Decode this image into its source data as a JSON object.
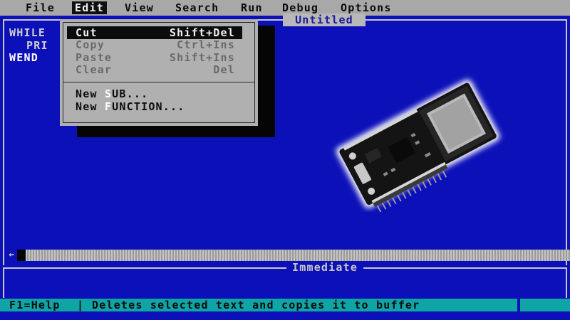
{
  "menubar": {
    "items": [
      "File",
      "Edit",
      "View",
      "Search",
      "Run",
      "Debug",
      "Options"
    ]
  },
  "editor": {
    "title": "Untitled",
    "code_lines": [
      "WHILE",
      "PRI",
      "WEND"
    ]
  },
  "edit_menu": {
    "items": [
      {
        "label": "Cut",
        "shortcut": "Shift+Del",
        "state": "selected"
      },
      {
        "label": "Copy",
        "shortcut": "Ctrl+Ins",
        "state": "disabled"
      },
      {
        "label": "Paste",
        "shortcut": "Shift+Ins",
        "state": "disabled"
      },
      {
        "label": "Clear",
        "shortcut": "Del",
        "state": "disabled"
      }
    ],
    "new_sub": {
      "prefix": "New ",
      "hotkey": "S",
      "rest": "UB..."
    },
    "new_function": {
      "prefix": "New ",
      "hotkey": "F",
      "rest": "UNCTION..."
    }
  },
  "immediate": {
    "label": "Immediate"
  },
  "scrollbar": {
    "left_arrow_icon": "left-arrow-icon"
  },
  "status": {
    "help": "F1=Help",
    "separator": "|",
    "message": "Deletes selected text and copies it to buffer"
  },
  "overlay_image": {
    "subject": "esp32-dev-board-photo"
  },
  "colors": {
    "background": "#0c10b8",
    "menubar": "#a8a8a8",
    "statusbar": "#0fa5a5",
    "menu_highlight": "#0c0c0c"
  }
}
